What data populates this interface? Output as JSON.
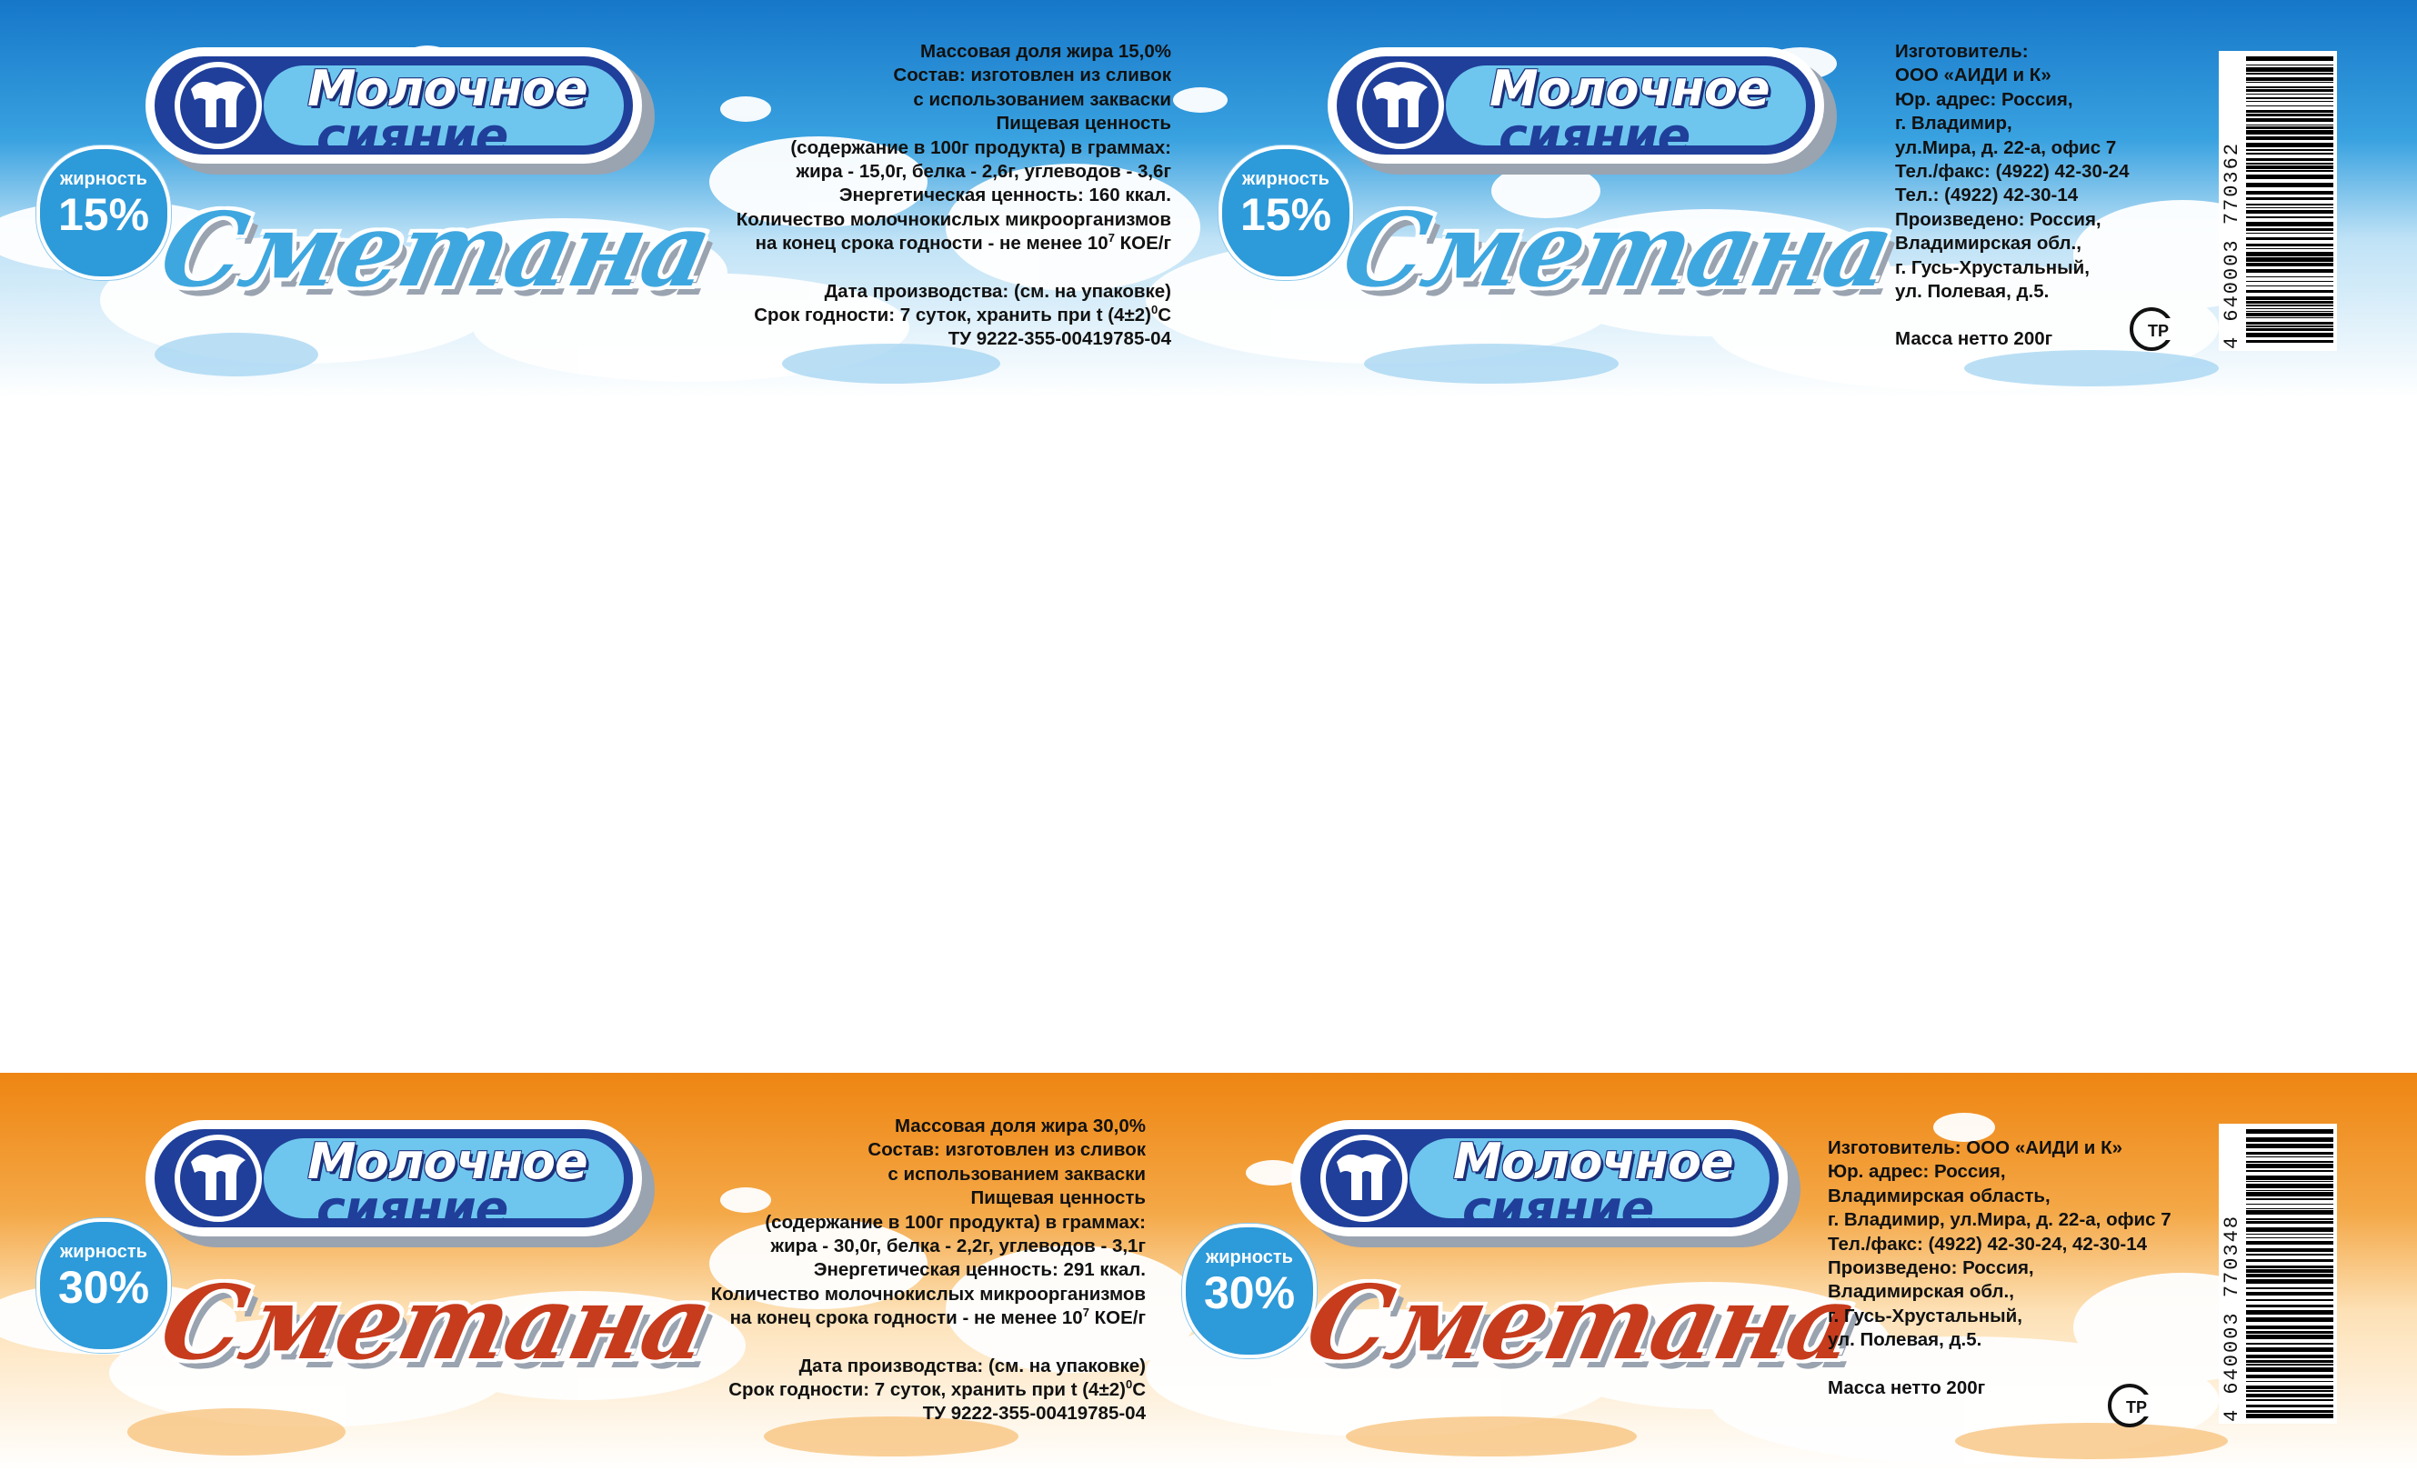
{
  "colors": {
    "top_sky": "#1d88d0",
    "top_accent": "#3fa7df",
    "bottom_sky": "#ef8a1a",
    "bottom_splash": "#f6c887",
    "product_red": "#c63c1d",
    "brand_navy": "#1f3f9a",
    "badge_blue": "#2d9ad9"
  },
  "labels": [
    {
      "variant": "15",
      "brand_line1": "Молочное",
      "brand_line2": "сияние",
      "badge_label": "жирность",
      "badge_value": "15%",
      "product": "Сметана",
      "info": {
        "fat": "Массовая доля жира 15,0%",
        "composition1": "Состав: изготовлен из сливок",
        "composition2": "с использованием закваски",
        "nutrition_title": "Пищевая ценность",
        "nutrition_sub": "(содержание в 100г продукта) в граммах:",
        "nutrition_values": "жира - 15,0г, белка - 2,6г, углеводов - 3,6г",
        "energy": "Энергетическая ценность: 160  ккал.",
        "microbes1": "Количество молочнокислых микроорганизмов",
        "microbes2": "на конец срока годности - не менее 10",
        "microbes_exp": "7",
        "microbes_unit": " КОЕ/г",
        "production_date": "Дата производства: (см. на упаковке)",
        "shelf_life": "Срок годности: 7 суток, хранить при t (4±2)",
        "shelf_deg": "0",
        "shelf_unit": "С",
        "tu": "ТУ 9222-355-00419785-04"
      },
      "maker": [
        "Изготовитель:",
        "ООО «АИДИ и К»",
        "Юр. адрес: Россия,",
        "г. Владимир,",
        "ул.Мира, д. 22-а, офис 7",
        "Тел./факс: (4922) 42-30-24",
        "Тел.: (4922) 42-30-14",
        "Произведено: Россия,",
        "Владимирская обл.,",
        "г. Гусь-Хрустальный,",
        "ул. Полевая, д.5."
      ],
      "net_mass": "Масса нетто 200г",
      "barcode_number": "4 640003 770362",
      "cert_mark": "TP"
    },
    {
      "variant": "30",
      "brand_line1": "Молочное",
      "brand_line2": "сияние",
      "badge_label": "жирность",
      "badge_value": "30%",
      "product": "Сметана",
      "info": {
        "fat": "Массовая доля жира 30,0%",
        "composition1": "Состав: изготовлен из сливок",
        "composition2": "с использованием закваски",
        "nutrition_title": "Пищевая ценность",
        "nutrition_sub": "(содержание в 100г продукта) в граммах:",
        "nutrition_values": "жира - 30,0г, белка - 2,2г, углеводов - 3,1г",
        "energy": "Энергетическая ценность: 291  ккал.",
        "microbes1": "Количество молочнокислых микроорганизмов",
        "microbes2": "на конец срока годности - не менее 10",
        "microbes_exp": "7",
        "microbes_unit": " КОЕ/г",
        "production_date": "Дата производства: (см. на упаковке)",
        "shelf_life": "Срок годности: 7 суток, хранить при t (4±2)",
        "shelf_deg": "0",
        "shelf_unit": "С",
        "tu": "ТУ 9222-355-00419785-04"
      },
      "maker": [
        "Изготовитель: ООО «АИДИ и К»",
        "Юр. адрес: Россия,",
        "Владимирская область,",
        "г. Владимир, ул.Мира, д. 22-а, офис 7",
        "Тел./факс: (4922) 42-30-24, 42-30-14",
        "Произведено: Россия,",
        "Владимирская обл.,",
        "г. Гусь-Хрустальный,",
        "ул. Полевая, д.5."
      ],
      "net_mass": "Масса нетто 200г",
      "barcode_number": "4 640003 770348",
      "cert_mark": "TP"
    }
  ]
}
